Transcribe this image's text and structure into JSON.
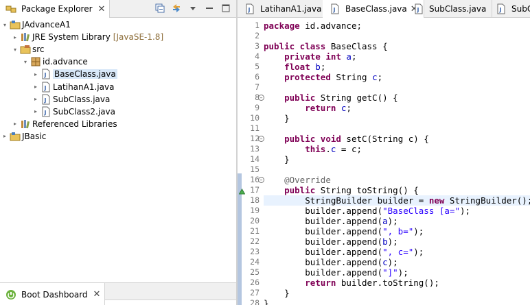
{
  "package_explorer": {
    "title": "Package Explorer",
    "tree": [
      {
        "label": "JAdvanceA1",
        "icon": "project-icon",
        "depth": 0,
        "twisty": "▾"
      },
      {
        "label": "JRE System Library",
        "decoration": "[JavaSE-1.8]",
        "icon": "library-icon",
        "depth": 1,
        "twisty": "▸"
      },
      {
        "label": "src",
        "icon": "source-folder-icon",
        "depth": 1,
        "twisty": "▾"
      },
      {
        "label": "id.advance",
        "icon": "package-icon",
        "depth": 2,
        "twisty": "▾"
      },
      {
        "label": "BaseClass.java",
        "icon": "java-file-icon",
        "depth": 3,
        "twisty": "▸",
        "selected": true
      },
      {
        "label": "LatihanA1.java",
        "icon": "java-file-icon",
        "depth": 3,
        "twisty": "▸"
      },
      {
        "label": "SubClass.java",
        "icon": "java-file-icon",
        "depth": 3,
        "twisty": "▸"
      },
      {
        "label": "SubClass2.java",
        "icon": "java-file-icon",
        "depth": 3,
        "twisty": "▸"
      },
      {
        "label": "Referenced Libraries",
        "icon": "library-icon",
        "depth": 1,
        "twisty": "▸"
      },
      {
        "label": "JBasic",
        "icon": "project-icon",
        "depth": 0,
        "twisty": "▸"
      }
    ]
  },
  "boot_dashboard": {
    "title": "Boot Dashboard"
  },
  "editor": {
    "tabs": [
      {
        "label": "LatihanA1.java",
        "active": false
      },
      {
        "label": "BaseClass.java",
        "active": true
      },
      {
        "label": "SubClass.java",
        "active": false
      },
      {
        "label": "SubC",
        "active": false
      }
    ],
    "lines": [
      [
        [
          "kw",
          "package"
        ],
        [
          "",
          "id.advance;"
        ]
      ],
      [],
      [
        [
          "kw",
          "public class"
        ],
        [
          "",
          "BaseClass {"
        ]
      ],
      [
        [
          "",
          "    "
        ],
        [
          "kw",
          "private int"
        ],
        [
          "fld",
          " a"
        ],
        [
          "",
          ";"
        ]
      ],
      [
        [
          "",
          "    "
        ],
        [
          "kw",
          "float"
        ],
        [
          "fld",
          " b"
        ],
        [
          "",
          ";"
        ]
      ],
      [
        [
          "",
          "    "
        ],
        [
          "kw",
          "protected"
        ],
        [
          "",
          " String "
        ],
        [
          "fld",
          "c"
        ],
        [
          "",
          ";"
        ]
      ],
      [],
      [
        [
          "",
          "    "
        ],
        [
          "kw",
          "public"
        ],
        [
          "",
          " String getC() {"
        ]
      ],
      [
        [
          "",
          "        "
        ],
        [
          "kw",
          "return"
        ],
        [
          "fld",
          " c"
        ],
        [
          "",
          ";"
        ]
      ],
      [
        [
          "",
          "    }"
        ]
      ],
      [],
      [
        [
          "",
          "    "
        ],
        [
          "kw",
          "public void"
        ],
        [
          "",
          " setC(String c) {"
        ]
      ],
      [
        [
          "",
          "        "
        ],
        [
          "kw",
          "this"
        ],
        [
          "",
          "."
        ],
        [
          "fld",
          "c"
        ],
        [
          "",
          " = c;"
        ]
      ],
      [
        [
          "",
          "    }"
        ]
      ],
      [],
      [
        [
          "",
          "    "
        ],
        [
          "ann",
          "@Override"
        ]
      ],
      [
        [
          "",
          "    "
        ],
        [
          "kw",
          "public"
        ],
        [
          "",
          " String toString() {"
        ]
      ],
      [
        [
          "",
          "        StringBuilder builder = "
        ],
        [
          "kw",
          "new"
        ],
        [
          "",
          " StringBuilder();"
        ]
      ],
      [
        [
          "",
          "        builder.append("
        ],
        [
          "str",
          "\"BaseClass [a=\""
        ],
        [
          "",
          ");"
        ]
      ],
      [
        [
          "",
          "        builder.append("
        ],
        [
          "fld",
          "a"
        ],
        [
          "",
          ");"
        ]
      ],
      [
        [
          "",
          "        builder.append("
        ],
        [
          "str",
          "\", b=\""
        ],
        [
          "",
          ");"
        ]
      ],
      [
        [
          "",
          "        builder.append("
        ],
        [
          "fld",
          "b"
        ],
        [
          "",
          ");"
        ]
      ],
      [
        [
          "",
          "        builder.append("
        ],
        [
          "str",
          "\", c=\""
        ],
        [
          "",
          ");"
        ]
      ],
      [
        [
          "",
          "        builder.append("
        ],
        [
          "fld",
          "c"
        ],
        [
          "",
          ");"
        ]
      ],
      [
        [
          "",
          "        builder.append("
        ],
        [
          "str",
          "\"]\""
        ],
        [
          "",
          ");"
        ]
      ],
      [
        [
          "",
          "        "
        ],
        [
          "kw",
          "return"
        ],
        [
          "",
          " builder.toString();"
        ]
      ],
      [
        [
          "",
          "    }"
        ]
      ],
      [
        [
          "",
          "}"
        ]
      ]
    ],
    "line_numbers": [
      "1",
      "2",
      "3",
      "4",
      "5",
      "6",
      "7",
      "8",
      "9",
      "10",
      "11",
      "12",
      "13",
      "14",
      "15",
      "16",
      "17",
      "18",
      "19",
      "20",
      "21",
      "22",
      "23",
      "24",
      "25",
      "26",
      "27",
      "28"
    ],
    "fold_lines": [
      8,
      12,
      16
    ],
    "override_marker_line": 17,
    "current_line": 18
  },
  "colors": {
    "keyword": "#7f0055",
    "field": "#0000c0",
    "string": "#2a00ff",
    "annotation": "#646464"
  }
}
